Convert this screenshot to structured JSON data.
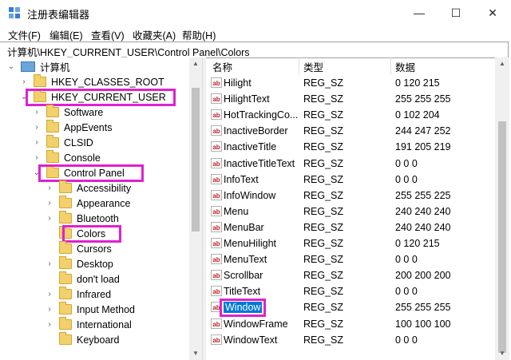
{
  "window": {
    "title": "注册表编辑器",
    "minimize": "—",
    "maximize": "☐",
    "close": "✕"
  },
  "menu": [
    "文件(F)",
    "编辑(E)",
    "查看(V)",
    "收藏夹(A)",
    "帮助(H)"
  ],
  "address": "计算机\\HKEY_CURRENT_USER\\Control Panel\\Colors",
  "tree": {
    "root": "计算机",
    "items": [
      {
        "label": "HKEY_CLASSES_ROOT",
        "depth": 1,
        "expander": "collapsed"
      },
      {
        "label": "HKEY_CURRENT_USER",
        "depth": 1,
        "expander": "expanded",
        "highlight": true
      },
      {
        "label": "Software",
        "depth": 2,
        "expander": "collapsed"
      },
      {
        "label": "AppEvents",
        "depth": 2,
        "expander": "collapsed"
      },
      {
        "label": "CLSID",
        "depth": 2,
        "expander": "collapsed"
      },
      {
        "label": "Console",
        "depth": 2,
        "expander": "collapsed"
      },
      {
        "label": "Control Panel",
        "depth": 2,
        "expander": "expanded",
        "highlight": true
      },
      {
        "label": "Accessibility",
        "depth": 3,
        "expander": "collapsed"
      },
      {
        "label": "Appearance",
        "depth": 3,
        "expander": "collapsed"
      },
      {
        "label": "Bluetooth",
        "depth": 3,
        "expander": "collapsed"
      },
      {
        "label": "Colors",
        "depth": 3,
        "expander": "none",
        "highlight": true,
        "selected": true
      },
      {
        "label": "Cursors",
        "depth": 3,
        "expander": "none"
      },
      {
        "label": "Desktop",
        "depth": 3,
        "expander": "collapsed"
      },
      {
        "label": "don't load",
        "depth": 3,
        "expander": "none"
      },
      {
        "label": "Infrared",
        "depth": 3,
        "expander": "collapsed"
      },
      {
        "label": "Input Method",
        "depth": 3,
        "expander": "collapsed"
      },
      {
        "label": "International",
        "depth": 3,
        "expander": "collapsed"
      },
      {
        "label": "Keyboard",
        "depth": 3,
        "expander": "none"
      }
    ]
  },
  "list": {
    "columns": [
      "名称",
      "类型",
      "数据"
    ],
    "rows": [
      {
        "name": "Hilight",
        "type": "REG_SZ",
        "data": "0 120 215"
      },
      {
        "name": "HilightText",
        "type": "REG_SZ",
        "data": "255 255 255"
      },
      {
        "name": "HotTrackingCo...",
        "type": "REG_SZ",
        "data": "0 102 204"
      },
      {
        "name": "InactiveBorder",
        "type": "REG_SZ",
        "data": "244 247 252"
      },
      {
        "name": "InactiveTitle",
        "type": "REG_SZ",
        "data": "191 205 219"
      },
      {
        "name": "InactiveTitleText",
        "type": "REG_SZ",
        "data": "0 0 0"
      },
      {
        "name": "InfoText",
        "type": "REG_SZ",
        "data": "0 0 0"
      },
      {
        "name": "InfoWindow",
        "type": "REG_SZ",
        "data": "255 255 225"
      },
      {
        "name": "Menu",
        "type": "REG_SZ",
        "data": "240 240 240"
      },
      {
        "name": "MenuBar",
        "type": "REG_SZ",
        "data": "240 240 240"
      },
      {
        "name": "MenuHilight",
        "type": "REG_SZ",
        "data": "0 120 215"
      },
      {
        "name": "MenuText",
        "type": "REG_SZ",
        "data": "0 0 0"
      },
      {
        "name": "Scrollbar",
        "type": "REG_SZ",
        "data": "200 200 200"
      },
      {
        "name": "TitleText",
        "type": "REG_SZ",
        "data": "0 0 0"
      },
      {
        "name": "Window",
        "type": "REG_SZ",
        "data": "255 255 255",
        "selected": true
      },
      {
        "name": "WindowFrame",
        "type": "REG_SZ",
        "data": "100 100 100"
      },
      {
        "name": "WindowText",
        "type": "REG_SZ",
        "data": "0 0 0"
      }
    ]
  },
  "icons": {
    "value_icon": "ab",
    "expanded": "⌄",
    "collapsed": "›"
  },
  "colors": {
    "highlight_box": "#e020d0",
    "selection": "#0078d7"
  }
}
